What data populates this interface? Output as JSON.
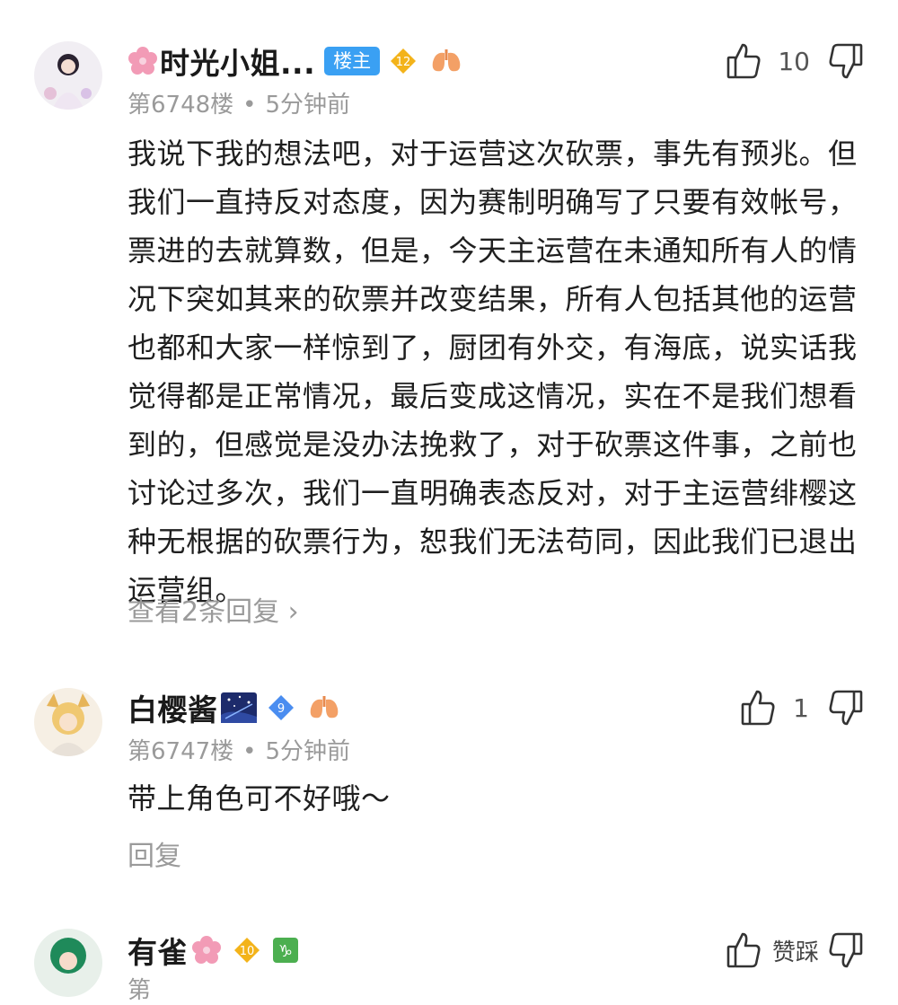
{
  "comments": [
    {
      "username": "时光小姐...",
      "owner_badge": "楼主",
      "level": "12",
      "floor": "第6748楼",
      "time": "5分钟前",
      "likes": "10",
      "text": "我说下我的想法吧，对于运营这次砍票，事先有预兆。但我们一直持反对态度，因为赛制明确写了只要有效帐号，票进的去就算数，但是，今天主运营在未通知所有人的情况下突如其来的砍票并改变结果，所有人包括其他的运营也都和大家一样惊到了，厨团有外交，有海底，说实话我觉得都是正常情况，最后变成这情况，实在不是我们想看到的，但感觉是没办法挽救了，对于砍票这件事，之前也讨论过多次，我们一直明确表态反对，对于主运营绯樱这种无根据的砍票行为，恕我们无法苟同，因此我们已退出运营组。",
      "reply_link": "查看2条回复 ›"
    },
    {
      "username": "白樱酱",
      "level": "9",
      "floor": "第6747楼",
      "time": "5分钟前",
      "likes": "1",
      "text": "带上角色可不好哦～",
      "reply_link": "回复"
    },
    {
      "username": "有雀",
      "level": "10",
      "floor": "第",
      "time": "",
      "likes": "赞踩",
      "text": ""
    }
  ],
  "colors": {
    "owner_badge_bg": "#3aa0f3",
    "level_gold": "#f3b31a",
    "level_blue": "#4a8df0",
    "meta_gray": "#9a9a9a"
  },
  "icons": [
    "cherry-blossom-icon",
    "level-badge-icon",
    "lung-icon",
    "thumb-up-icon",
    "thumb-down-icon",
    "night-sky-icon",
    "zodiac-capricorn-icon"
  ]
}
